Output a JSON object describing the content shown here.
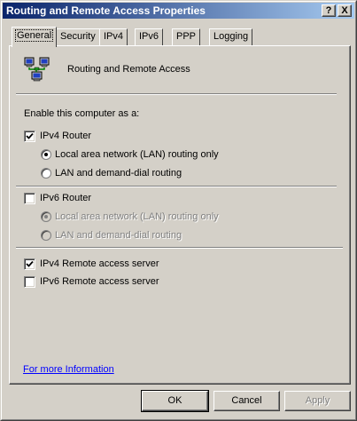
{
  "window": {
    "title": "Routing and Remote Access Properties",
    "help_glyph": "?",
    "close_glyph": "X"
  },
  "tabs": [
    {
      "label": "General",
      "active": true
    },
    {
      "label": "Security"
    },
    {
      "label": "IPv4"
    },
    {
      "label": "IPv6"
    },
    {
      "label": "PPP"
    },
    {
      "label": "Logging"
    }
  ],
  "general": {
    "header_icon": "network-computers-icon",
    "header_text": "Routing and Remote Access",
    "enable_label": "Enable this computer as a:",
    "ipv4_router": {
      "label": "IPv4 Router",
      "checked": true,
      "options": [
        {
          "label": "Local area network (LAN) routing only",
          "selected": true
        },
        {
          "label": "LAN and demand-dial routing",
          "selected": false
        }
      ]
    },
    "ipv6_router": {
      "label": "IPv6 Router",
      "checked": false,
      "options": [
        {
          "label": "Local area network (LAN) routing only",
          "selected": true,
          "disabled": true
        },
        {
          "label": "LAN and demand-dial routing",
          "selected": false,
          "disabled": true
        }
      ]
    },
    "ipv4_ras": {
      "label": "IPv4 Remote access server",
      "checked": true
    },
    "ipv6_ras": {
      "label": "IPv6 Remote access server",
      "checked": false
    },
    "more_info_link": "For more Information"
  },
  "buttons": {
    "ok": "OK",
    "cancel": "Cancel",
    "apply": "Apply"
  },
  "colors": {
    "face": "#d4d0c8",
    "title_start": "#0a246a",
    "title_end": "#a6caf0",
    "link": "#0000ff"
  }
}
